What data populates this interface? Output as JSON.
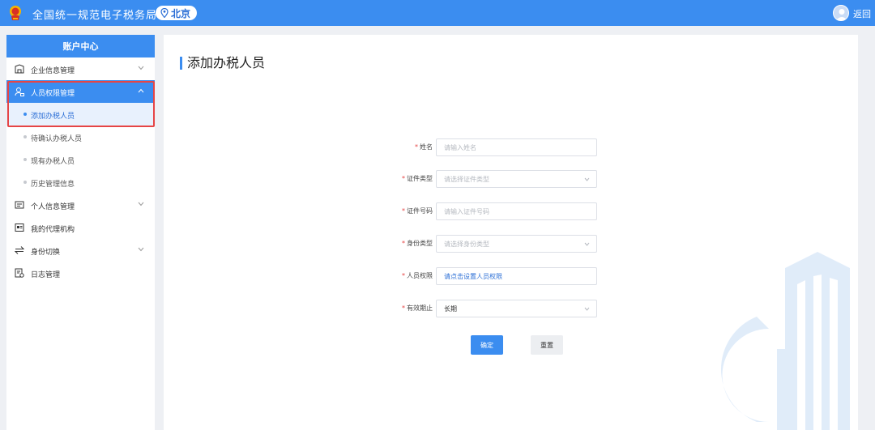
{
  "header": {
    "site_title": "全国统一规范电子税务局",
    "region": "北京",
    "back_label": "返回"
  },
  "sidebar": {
    "title": "账户中心",
    "items": [
      {
        "label": "企业信息管理",
        "icon": "building-icon",
        "expandable": true
      },
      {
        "label": "人员权限管理",
        "icon": "user-lock-icon",
        "expandable": true,
        "expanded": true,
        "children": [
          "添加办税人员",
          "待确认办税人员",
          "现有办税人员",
          "历史管理信息"
        ]
      },
      {
        "label": "个人信息管理",
        "icon": "id-card-icon",
        "expandable": true
      },
      {
        "label": "我的代理机构",
        "icon": "agency-icon",
        "expandable": false
      },
      {
        "label": "身份切换",
        "icon": "switch-icon",
        "expandable": true
      },
      {
        "label": "日志管理",
        "icon": "log-icon",
        "expandable": false
      }
    ],
    "selected_child": "添加办税人员"
  },
  "main": {
    "title": "添加办税人员",
    "form": {
      "name": {
        "label": "姓名",
        "placeholder": "请输入姓名"
      },
      "cert_type": {
        "label": "证件类型",
        "placeholder": "请选择证件类型"
      },
      "cert_number": {
        "label": "证件号码",
        "placeholder": "请输入证件号码"
      },
      "identity_type": {
        "label": "身份类型",
        "placeholder": "请选择身份类型"
      },
      "permission": {
        "label": "人员权限",
        "value": "请点击设置人员权限"
      },
      "valid_until": {
        "label": "有效期止",
        "value": "长期"
      }
    },
    "confirm_label": "确定",
    "reset_label": "重置"
  },
  "colors": {
    "primary": "#3b8df0",
    "required": "#e64545",
    "highlight_border": "#e64545"
  }
}
